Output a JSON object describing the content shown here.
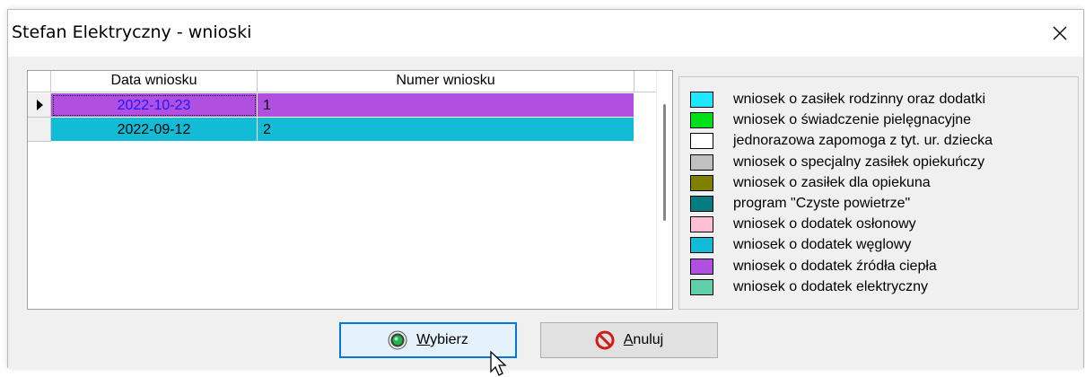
{
  "window": {
    "title": "Stefan Elektryczny - wnioski",
    "close_icon": "close-icon"
  },
  "grid": {
    "columns": [
      "Data wniosku",
      "Numer wniosku"
    ],
    "rows": [
      {
        "date": "2022-10-23",
        "number": "1",
        "color": "#b04fe0",
        "date_text_color": "#1a1aff",
        "selected": true
      },
      {
        "date": "2022-09-12",
        "number": "2",
        "color": "#13bcd6",
        "date_text_color": "#000000",
        "selected": false
      }
    ]
  },
  "legend": {
    "items": [
      {
        "label": "wniosek o zasiłek rodzinny oraz dodatki",
        "color": "#1ee8ff"
      },
      {
        "label": "wniosek o świadczenie pielęgnacyjne",
        "color": "#00e01a"
      },
      {
        "label": "jednorazowa zapomoga z tyt. ur. dziecka",
        "color": "#ffffff"
      },
      {
        "label": "wniosek o specjalny zasiłek opiekuńczy",
        "color": "#c0c0c0"
      },
      {
        "label": "wniosek o zasiłek dla opiekuna",
        "color": "#808000"
      },
      {
        "label": "program \"Czyste powietrze\"",
        "color": "#047c82"
      },
      {
        "label": "wniosek o dodatek osłonowy",
        "color": "#ffc0d6"
      },
      {
        "label": "wniosek o dodatek węglowy",
        "color": "#13bcd6"
      },
      {
        "label": "wniosek o dodatek źródła ciepła",
        "color": "#b04fe0"
      },
      {
        "label": "wniosek o dodatek elektryczny",
        "color": "#5fd0a8"
      }
    ]
  },
  "buttons": {
    "select": {
      "mnemonic": "W",
      "rest": "ybierz",
      "icon": "green-radio-icon"
    },
    "cancel": {
      "mnemonic": "A",
      "rest": "nuluj",
      "icon": "no-entry-icon"
    }
  }
}
